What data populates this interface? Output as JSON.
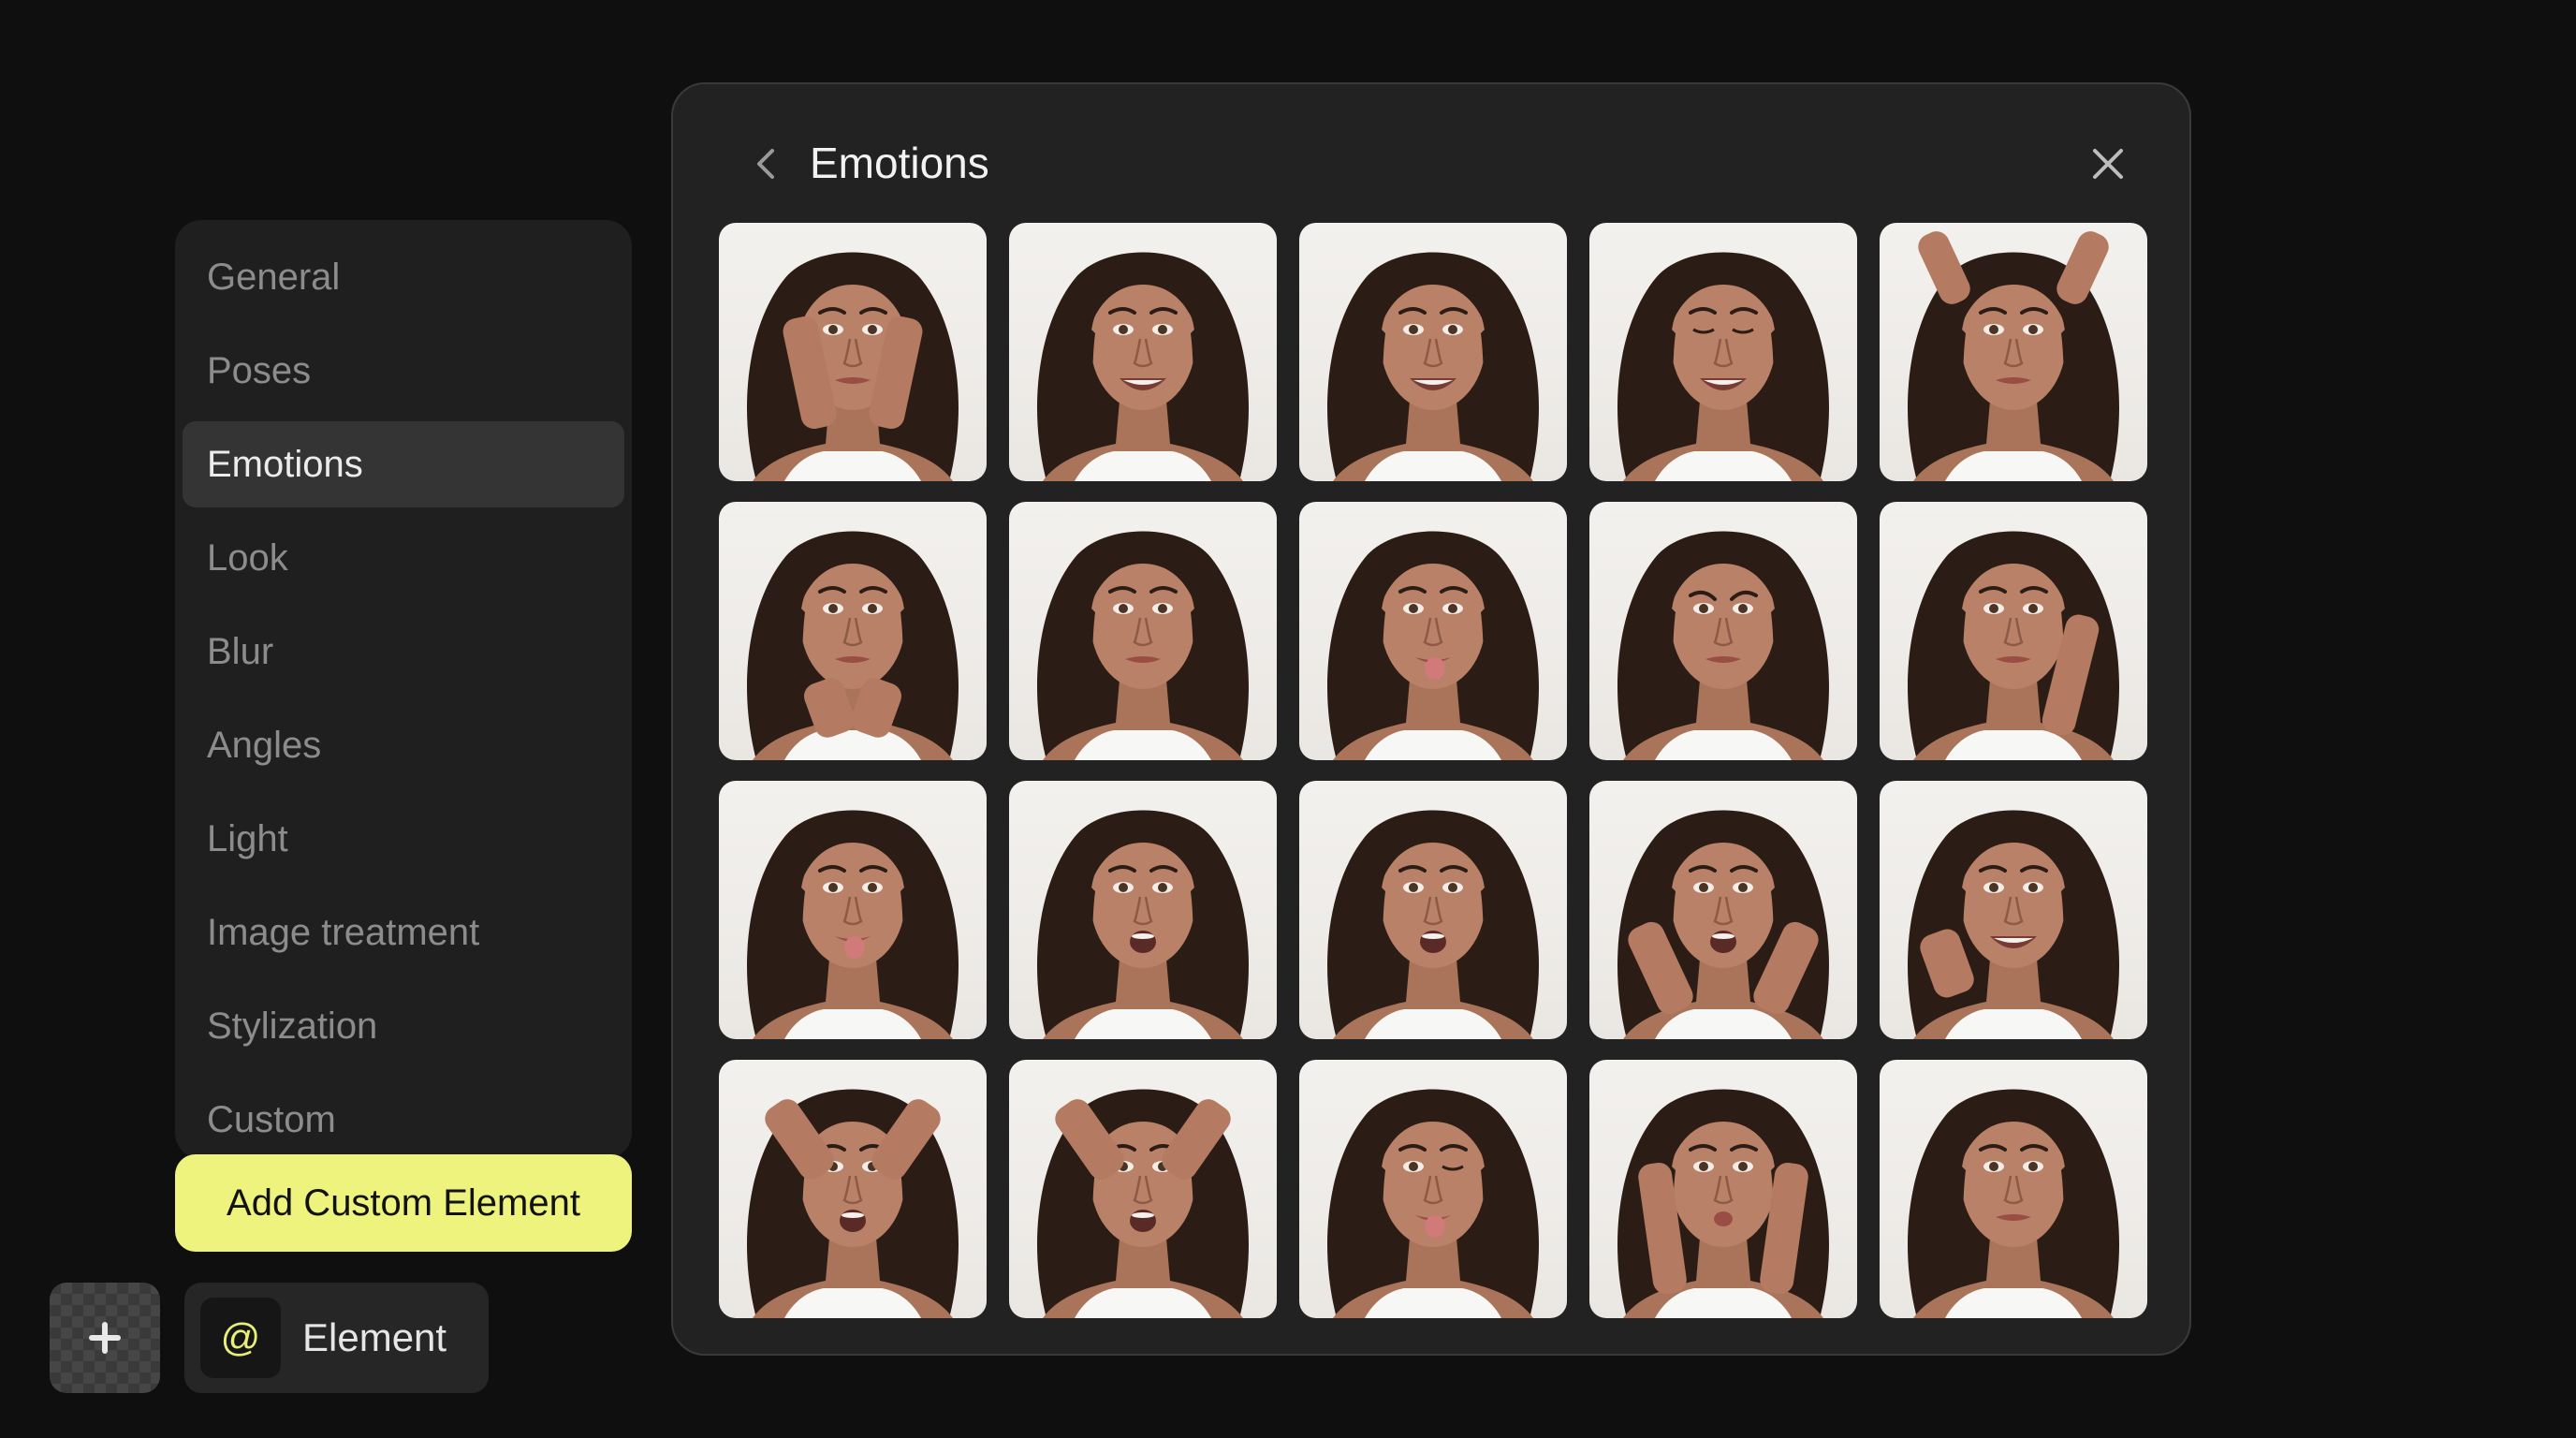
{
  "sidebar": {
    "items": [
      {
        "label": "General",
        "active": false
      },
      {
        "label": "Poses",
        "active": false
      },
      {
        "label": "Emotions",
        "active": true
      },
      {
        "label": "Look",
        "active": false
      },
      {
        "label": "Blur",
        "active": false
      },
      {
        "label": "Angles",
        "active": false
      },
      {
        "label": "Light",
        "active": false
      },
      {
        "label": "Image treatment",
        "active": false
      },
      {
        "label": "Stylization",
        "active": false
      },
      {
        "label": "Custom",
        "active": false
      }
    ],
    "add_button_label": "Add Custom Element"
  },
  "bottom_bar": {
    "plus_icon": "plus-icon",
    "element_chip": {
      "icon_glyph": "@",
      "label": "Element"
    }
  },
  "panel": {
    "title": "Emotions",
    "back_icon": "chevron-left-icon",
    "close_icon": "close-icon",
    "thumbnails": [
      {
        "expression": "hands-on-face",
        "hands": "cheeks",
        "mouth": "neutral",
        "eyes": "open"
      },
      {
        "expression": "big-smile",
        "hands": "none",
        "mouth": "smile",
        "eyes": "open"
      },
      {
        "expression": "smile",
        "hands": "none",
        "mouth": "smile",
        "eyes": "open"
      },
      {
        "expression": "laugh",
        "hands": "none",
        "mouth": "smile",
        "eyes": "squint"
      },
      {
        "expression": "horns-gesture",
        "hands": "above-head",
        "mouth": "neutral",
        "eyes": "open"
      },
      {
        "expression": "chin-on-hands",
        "hands": "chin",
        "mouth": "neutral",
        "eyes": "open"
      },
      {
        "expression": "neutral",
        "hands": "none",
        "mouth": "neutral",
        "eyes": "open"
      },
      {
        "expression": "tongue-side",
        "hands": "none",
        "mouth": "tongue",
        "eyes": "open"
      },
      {
        "expression": "frown",
        "hands": "none",
        "mouth": "neutral",
        "eyes": "frown"
      },
      {
        "expression": "hand-on-cheek",
        "hands": "right-cheek",
        "mouth": "neutral",
        "eyes": "open"
      },
      {
        "expression": "tongue-out",
        "hands": "none",
        "mouth": "tongue",
        "eyes": "open"
      },
      {
        "expression": "surprised",
        "hands": "none",
        "mouth": "open",
        "eyes": "open"
      },
      {
        "expression": "pout",
        "hands": "none",
        "mouth": "open",
        "eyes": "open"
      },
      {
        "expression": "shocked",
        "hands": "beside-face",
        "mouth": "open",
        "eyes": "open"
      },
      {
        "expression": "small-gesture",
        "hands": "right-pinch",
        "mouth": "smile",
        "eyes": "open"
      },
      {
        "expression": "stressed",
        "hands": "on-head",
        "mouth": "open",
        "eyes": "open"
      },
      {
        "expression": "worried",
        "hands": "on-head",
        "mouth": "open",
        "eyes": "open"
      },
      {
        "expression": "wink-tongue",
        "hands": "none",
        "mouth": "tongue",
        "eyes": "wink"
      },
      {
        "expression": "rock-on",
        "hands": "rock-sign",
        "mouth": "pout",
        "eyes": "open"
      },
      {
        "expression": "calm",
        "hands": "none",
        "mouth": "neutral",
        "eyes": "open"
      }
    ]
  },
  "colors": {
    "background": "#0f0f0f",
    "panel": "#222222",
    "sidebar": "#1f1f1f",
    "accent": "#eef37d",
    "active_item": "#343434"
  }
}
